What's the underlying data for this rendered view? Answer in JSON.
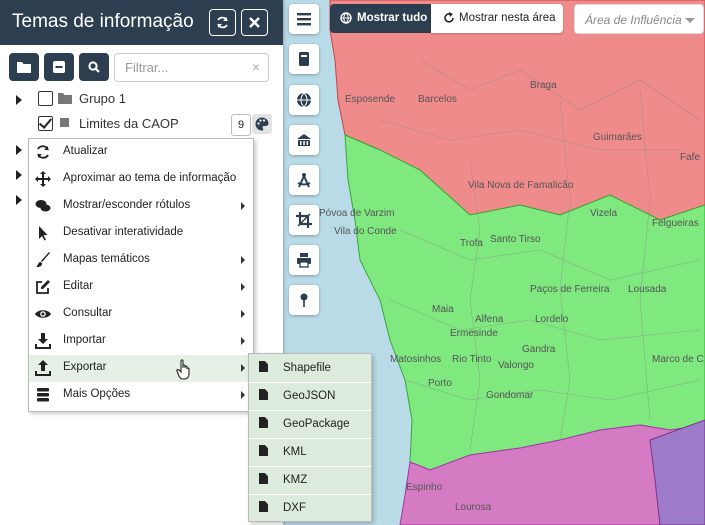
{
  "panel": {
    "title": "Temas de informação",
    "filter_placeholder": "Filtrar...",
    "clear_symbol": "×"
  },
  "tree": {
    "grupo1": "Grupo 1",
    "limites": "Limites da CAOP",
    "limites_badge": "9"
  },
  "context_menu": [
    "Atualizar",
    "Aproximar ao tema de informação",
    "Mostrar/esconder rótulos",
    "Desativar interatividade",
    "Mapas temáticos",
    "Editar",
    "Consultar",
    "Importar",
    "Exportar",
    "Mais Opções"
  ],
  "export_submenu": [
    "Shapefile",
    "GeoJSON",
    "GeoPackage",
    "KML",
    "KMZ",
    "DXF"
  ],
  "top_controls": {
    "mostrar_tudo": "Mostrar tudo",
    "mostrar_area": "Mostrar nesta área",
    "area_placeholder": "Área de Influência"
  },
  "map_labels": {
    "vila_do_conde": "Vila do Conde",
    "povoa": "Póvoa de Varzim",
    "esposende": "Esposende",
    "barcelos": "Barcelos",
    "braga": "Braga",
    "guimaraes": "Guimarães",
    "fafe": "Fafe",
    "famalicao": "Vila Nova de Famalicão",
    "trofa": "Trofa",
    "santo_tirso": "Santo Tirso",
    "felgueiras": "Felgueiras",
    "lousada": "Lousada",
    "pacos": "Paços de Ferreira",
    "maia": "Maia",
    "valongo": "Valongo",
    "lordelo": "Lordelo",
    "matosinhos": "Matosinhos",
    "rio_tinto": "Rio Tinto",
    "ermesinde": "Ermesinde",
    "alfena": "Alfena",
    "gandra": "Gandra",
    "porto": "Porto",
    "gondomar": "Gondomar",
    "marco": "Marco de C",
    "espinho": "Espinho",
    "lourosa": "Lourosa",
    "vizela": "Vizela"
  },
  "colors": {
    "header": "#2d3e50",
    "red_region": "#f08b8b",
    "green_region": "#7fe87f",
    "magenta_region": "#d57bc4",
    "purple_region": "#9d7bc9",
    "sea": "#b9dbe8"
  }
}
